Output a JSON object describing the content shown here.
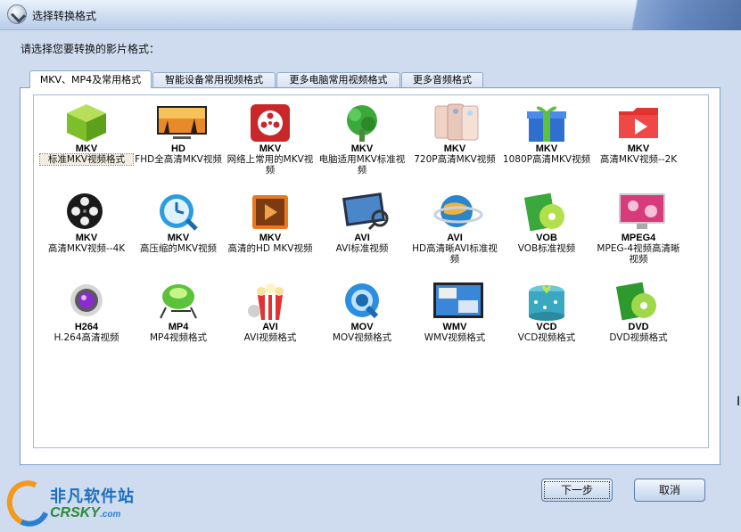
{
  "window": {
    "title": "选择转换格式"
  },
  "prompt": "请选择您要转换的影片格式：",
  "tabs": [
    {
      "label": "MKV、MP4及常用格式",
      "active": true
    },
    {
      "label": "智能设备常用视频格式",
      "active": false
    },
    {
      "label": "更多电脑常用视频格式",
      "active": false
    },
    {
      "label": "更多音频格式",
      "active": false
    }
  ],
  "formats": [
    {
      "fmt": "MKV",
      "label": "标准MKV视频格式",
      "icon": "green-box-icon",
      "selected": true
    },
    {
      "fmt": "HD",
      "label": "FHD全高清MKV视频",
      "icon": "tv-icon",
      "selected": false
    },
    {
      "fmt": "MKV",
      "label": "网络上常用的MKV视频",
      "icon": "film-reel-red-icon",
      "selected": false
    },
    {
      "fmt": "MKV",
      "label": "电脑适用MKV标准视频",
      "icon": "green-tree-icon",
      "selected": false
    },
    {
      "fmt": "MKV",
      "label": "720P高清MKV视频",
      "icon": "phones-icon",
      "selected": false
    },
    {
      "fmt": "MKV",
      "label": "1080P高清MKV视频",
      "icon": "gift-box-icon",
      "selected": false
    },
    {
      "fmt": "MKV",
      "label": "高清MKV视频--2K",
      "icon": "red-play-folder-icon",
      "selected": false
    },
    {
      "fmt": "MKV",
      "label": "高清MKV视频--4K",
      "icon": "film-reel-black-icon",
      "selected": false
    },
    {
      "fmt": "MKV",
      "label": "高压缩的MKV视频",
      "icon": "blue-clock-icon",
      "selected": false
    },
    {
      "fmt": "MKV",
      "label": "高清的HD MKV视频",
      "icon": "orange-play-icon",
      "selected": false
    },
    {
      "fmt": "AVI",
      "label": "AVI标准视频",
      "icon": "monitor-magnifier-icon",
      "selected": false
    },
    {
      "fmt": "AVI",
      "label": "HD高清晰AVI标准视频",
      "icon": "globe-ring-icon",
      "selected": false
    },
    {
      "fmt": "VOB",
      "label": "VOB标准视频",
      "icon": "green-disc-case-icon",
      "selected": false
    },
    {
      "fmt": "MPEG4",
      "label": "MPEG-4视频高清晰视频",
      "icon": "pink-monitor-icon",
      "selected": false
    },
    {
      "fmt": "H264",
      "label": "H.264高清视频",
      "icon": "purple-orb-icon",
      "selected": false
    },
    {
      "fmt": "MP4",
      "label": "MP4视频格式",
      "icon": "green-lamp-icon",
      "selected": false
    },
    {
      "fmt": "AVI",
      "label": "AVI视频格式",
      "icon": "popcorn-icon",
      "selected": false
    },
    {
      "fmt": "MOV",
      "label": "MOV视频格式",
      "icon": "quicktime-icon",
      "selected": false
    },
    {
      "fmt": "WMV",
      "label": "WMV视频格式",
      "icon": "windows-screen-icon",
      "selected": false
    },
    {
      "fmt": "VCD",
      "label": "VCD视频格式",
      "icon": "teal-gift-box-icon",
      "selected": false
    },
    {
      "fmt": "DVD",
      "label": "DVD视频格式",
      "icon": "green-dvd-case-icon",
      "selected": false
    }
  ],
  "buttons": {
    "next": "下一步",
    "cancel": "取消"
  },
  "logo": {
    "cn": "非凡软件站",
    "en": "CRSKY",
    "domain": ".com"
  }
}
